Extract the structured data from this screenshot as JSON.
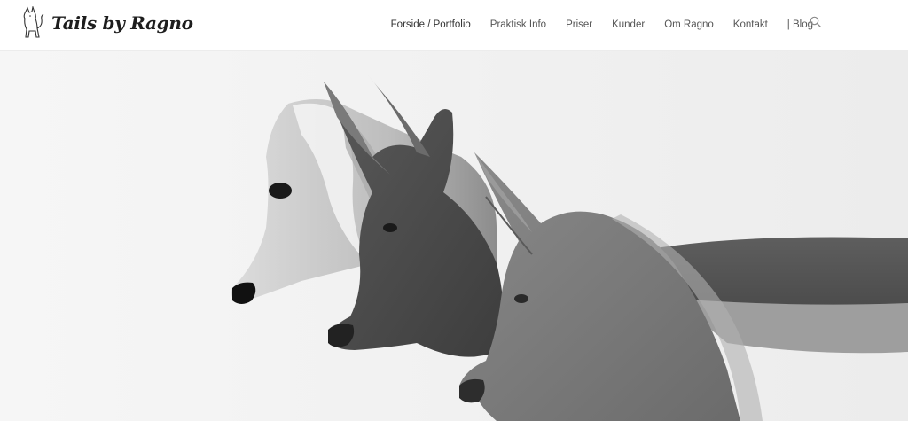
{
  "site": {
    "logo_text": "Tails by Ragno",
    "logo_icon": "dog-outline-icon"
  },
  "nav": {
    "items": [
      {
        "label": "Forside / Portfolio",
        "active": true
      },
      {
        "label": "Praktisk Info"
      },
      {
        "label": "Priser"
      },
      {
        "label": "Kunder"
      },
      {
        "label": "Om Ragno"
      },
      {
        "label": "Kontakt"
      },
      {
        "label": "| Blog"
      }
    ],
    "search_icon": "search-icon"
  },
  "hero": {
    "image": "black-and-white photo of three dogs in profile (saluki and two pharaoh hounds)"
  },
  "colors": {
    "header_bg": "#ffffff",
    "nav_text": "#555555",
    "hero_bg": "#f0f0f0"
  }
}
